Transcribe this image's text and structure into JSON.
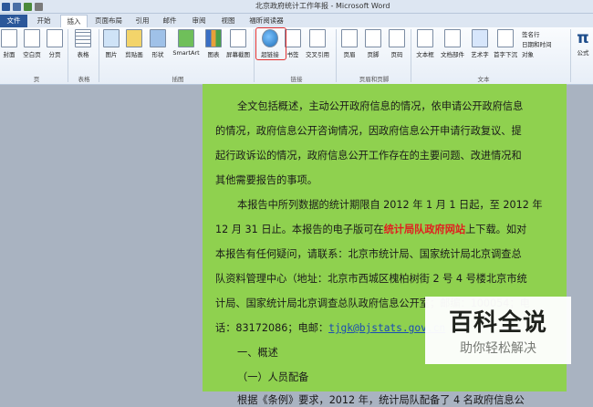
{
  "window": {
    "title": "北京政府统计工作年报 - Microsoft Word"
  },
  "tabs": [
    "文件",
    "开始",
    "插入",
    "页面布局",
    "引用",
    "邮件",
    "审阅",
    "视图",
    "福昕阅读器"
  ],
  "ribbon": {
    "buttons": [
      {
        "label": "封面"
      },
      {
        "label": "空白页"
      },
      {
        "label": "分页"
      },
      {
        "label": "表格"
      },
      {
        "label": "图片"
      },
      {
        "label": "剪贴画"
      },
      {
        "label": "形状"
      },
      {
        "label": "SmartArt"
      },
      {
        "label": "图表"
      },
      {
        "label": "屏幕截图"
      },
      {
        "label": "超链接"
      },
      {
        "label": "书签"
      },
      {
        "label": "交叉引用"
      },
      {
        "label": "页眉"
      },
      {
        "label": "页脚"
      },
      {
        "label": "页码"
      },
      {
        "label": "文本框"
      },
      {
        "label": "文档部件"
      },
      {
        "label": "艺术字"
      },
      {
        "label": "首字下沉"
      }
    ],
    "side_items": [
      "签名行",
      "日期和时间",
      "对象"
    ],
    "formula_label": "公式",
    "groups": [
      "页",
      "表格",
      "插图",
      "链接",
      "页眉和页脚",
      "文本"
    ]
  },
  "document": {
    "para1_lines": [
      "全文包括概述，主动公开政府信息的情况，依申请公开政府信息",
      "的情况，政府信息公开咨询情况，因政府信息公开申请行政复议、提",
      "起行政诉讼的情况，政府信息公开工作存在的主要问题、改进情况和",
      "其他需要报告的事项。"
    ],
    "para2_line1": "本报告中所列数据的统计期限自 2012 年 1 月 1 日起，至 2012 年",
    "para2_line2_pre": "12 月 31 日止。本报告的电子版可在",
    "para2_line2_red": "统计局队政府网站",
    "para2_line2_post": "上下载。如对",
    "para2_lines_rest": [
      "本报告有任何疑问，请联系：北京市统计局、国家统计局北京调查总",
      "队资料管理中心（地址：北京市西城区槐柏树街 2 号 4 号楼北京市统",
      "计局、国家统计局北京调查总队政府信息公开室；邮编：100054；电"
    ],
    "para2_last_pre": "话：83172086；电邮：",
    "para2_last_link": "tjgk@bjstats.gov.cn",
    "heading1": "一、概述",
    "heading2": "（一）人员配备",
    "para3": "根据《条例》要求，2012 年，统计局队配备了 4 名政府信息公"
  },
  "watermark": {
    "main": "百科全说",
    "sub": "助你轻松解决"
  },
  "colors": {
    "page_bg": "#8fd14f",
    "accent": "#2b579a",
    "highlight": "#e03030"
  }
}
